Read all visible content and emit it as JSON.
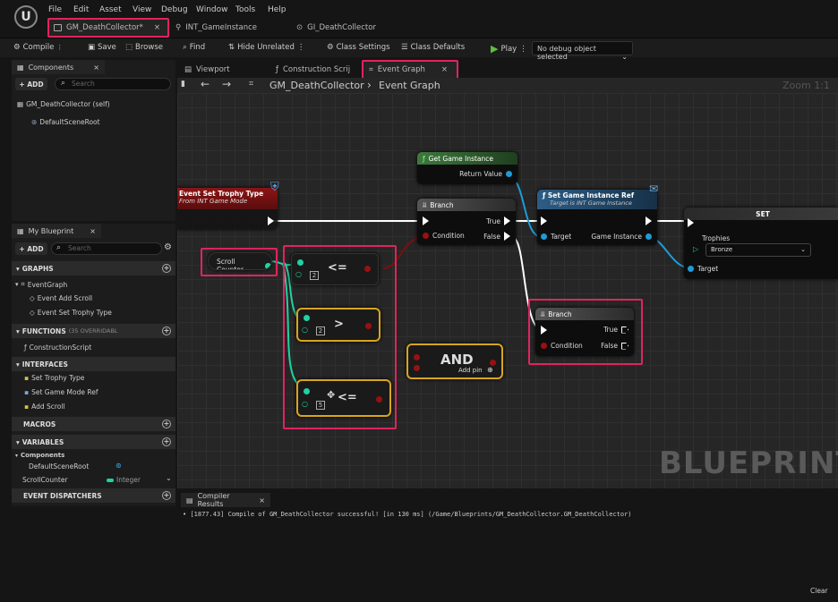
{
  "menu": {
    "items": [
      "File",
      "Edit",
      "Asset",
      "View",
      "Debug",
      "Window",
      "Tools",
      "Help"
    ]
  },
  "doc_tabs": [
    {
      "label": "GM_DeathCollector*",
      "close": "×"
    },
    {
      "label": "INT_GameInstance"
    },
    {
      "label": "GI_DeathCollector"
    }
  ],
  "toolbar": {
    "compile": "Compile",
    "save": "Save",
    "browse": "Browse",
    "find": "Find",
    "hide_unrelated": "Hide Unrelated",
    "class_settings": "Class Settings",
    "class_defaults": "Class Defaults",
    "play": "Play",
    "debug_object": "No debug object selected"
  },
  "components_panel": {
    "tab": "Components",
    "add": "+ ADD",
    "search_placeholder": "Search",
    "root_item": "GM_DeathCollector (self)",
    "child_item": "DefaultSceneRoot"
  },
  "my_blueprint": {
    "tab": "My Blueprint",
    "add": "+ ADD",
    "search_placeholder": "Search",
    "graphs_header": "GRAPHS",
    "graphs": [
      "EventGraph",
      "Event Add Scroll",
      "Event Set Trophy Type"
    ],
    "functions_header": "FUNCTIONS",
    "functions_note": "(35 OVERRIDABL",
    "functions": [
      "ConstructionScript"
    ],
    "interfaces_header": "INTERFACES",
    "interfaces": [
      "Set Trophy Type",
      "Set Game Mode Ref",
      "Add Scroll"
    ],
    "macros_header": "MACROS",
    "variables_header": "VARIABLES",
    "components_sub": "Components",
    "var_items": [
      {
        "name": "DefaultSceneRoot",
        "type": ""
      },
      {
        "name": "ScrollCounter",
        "type": "Integer"
      }
    ],
    "dispatchers_header": "EVENT DISPATCHERS"
  },
  "graph_tabs": {
    "viewport": "Viewport",
    "construction": "Construction Scrij",
    "event_graph": "Event Graph"
  },
  "breadcrumb": {
    "class": "GM_DeathCollector",
    "separator": "›",
    "graph": "Event Graph",
    "zoom": "Zoom 1:1"
  },
  "nodes": {
    "event_title": "Event Set Trophy Type",
    "event_sub": "From INT Game Mode",
    "get_gi_title": "Get Game Instance",
    "get_gi_pin": "Return Value",
    "branch1_title": "Branch",
    "branch_true": "True",
    "branch_false": "False",
    "branch_condition": "Condition",
    "set_gi_title": "Set Game Instance Ref",
    "set_gi_sub": "Target is INT Game Instance",
    "set_gi_target": "Target",
    "set_gi_out": "Game Instance",
    "set_title": "SET",
    "set_trophies": "Trophies",
    "set_trophies_value": "Bronze",
    "set_target": "Target",
    "scroll_counter": "Scroll Counter",
    "op1": "<=",
    "op1_value": "2",
    "op2": ">",
    "op2_value": "2",
    "op3": "<=",
    "op3_value": "5",
    "and_title": "AND",
    "and_addpin": "Add pin",
    "branch2_title": "Branch"
  },
  "watermark": "BLUEPRINT",
  "compiler": {
    "tab": "Compiler Results",
    "message": "[1877.43] Compile of GM_DeathCollector successful! [in 130 ms] (/Game/Blueprints/GM_DeathCollector.GM_DeathCollector)",
    "clear": "Clear"
  },
  "colors": {
    "highlight": "#e0245e",
    "exec_wire": "#ffffff",
    "object_pin": "#1e9bd7",
    "bool_pin": "#9a1010",
    "int_pin": "#1fd2a4",
    "event_header": "#8b1515",
    "function_header": "#2d5d86",
    "pure_header": "#3d7a3d",
    "operator_border": "#d8a520"
  }
}
